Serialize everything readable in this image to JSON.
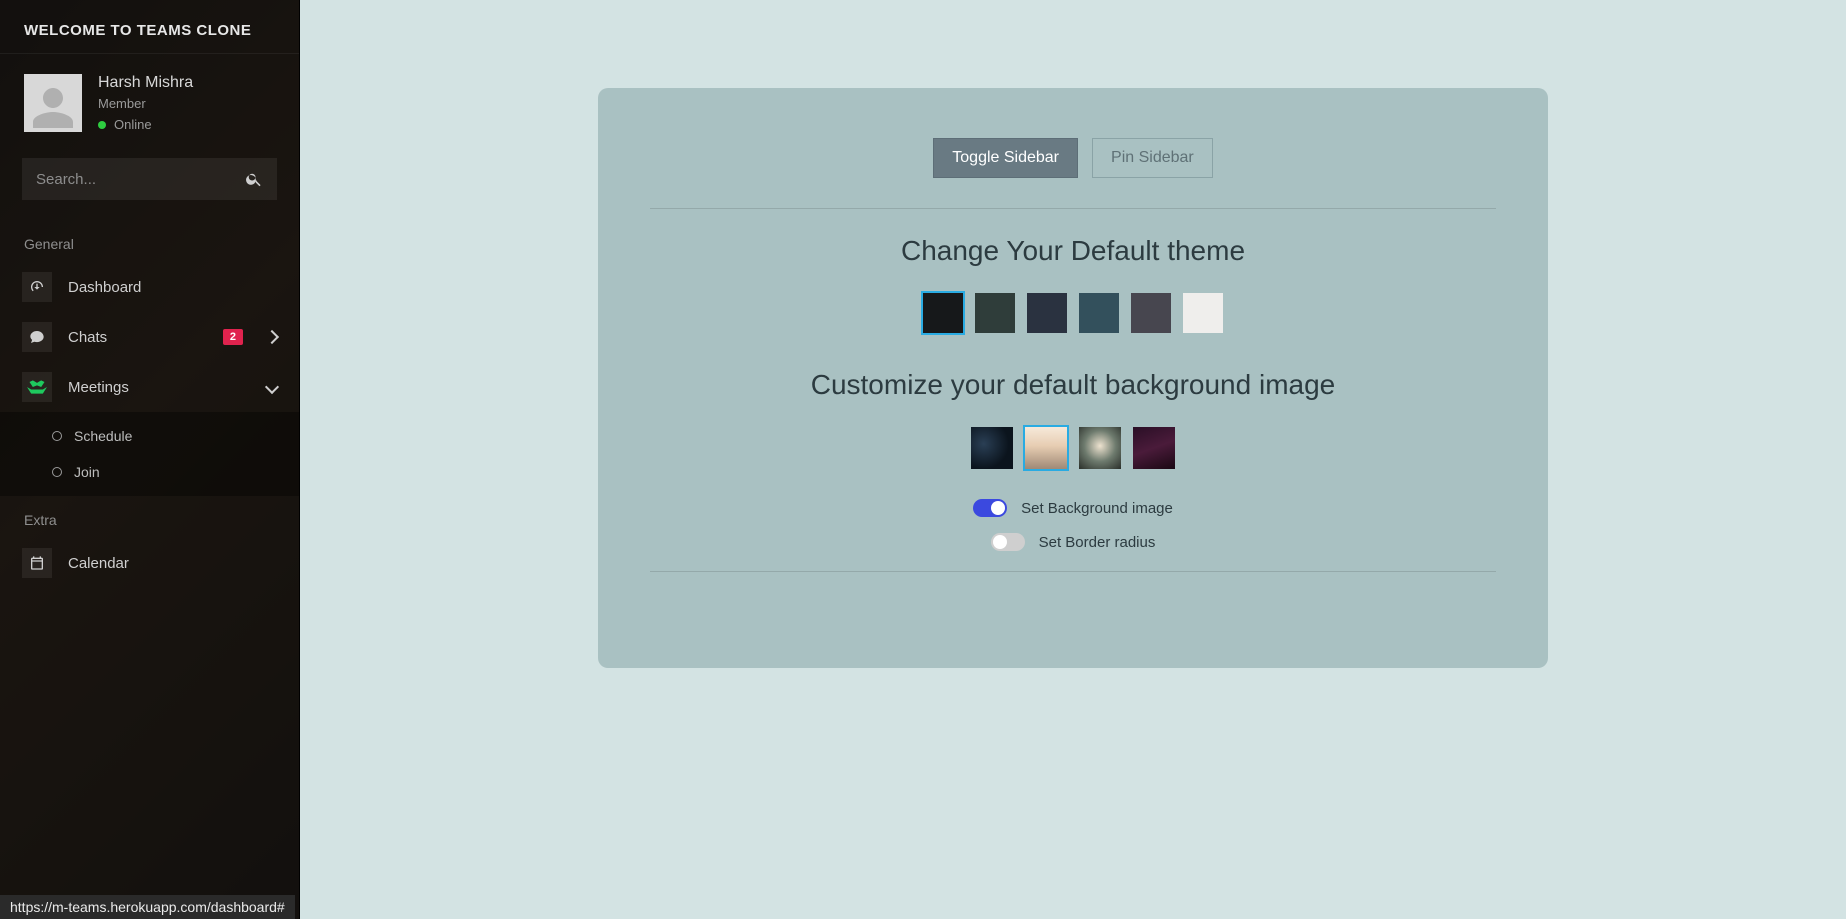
{
  "sidebar": {
    "title": "WELCOME TO TEAMS CLONE",
    "profile": {
      "name": "Harsh Mishra",
      "role": "Member",
      "status_text": "Online"
    },
    "search_placeholder": "Search...",
    "sections": {
      "general_label": "General",
      "extra_label": "Extra"
    },
    "items": {
      "dashboard": "Dashboard",
      "chats": "Chats",
      "chats_badge": "2",
      "meetings": "Meetings",
      "calendar": "Calendar"
    },
    "meetings_sub": {
      "schedule": "Schedule",
      "join": "Join"
    }
  },
  "panel": {
    "toggle_sidebar": "Toggle Sidebar",
    "pin_sidebar": "Pin Sidebar",
    "theme_heading": "Change Your Default theme",
    "bg_heading": "Customize your default background image",
    "set_bg_label": "Set Background image",
    "set_radius_label": "Set Border radius",
    "themes": [
      {
        "color": "#16181a",
        "selected": true
      },
      {
        "color": "#2f3d3a",
        "selected": false
      },
      {
        "color": "#2a3240",
        "selected": false
      },
      {
        "color": "#33505c",
        "selected": false
      },
      {
        "color": "#47464f",
        "selected": false
      },
      {
        "color": "#efeeec",
        "selected": false
      }
    ],
    "backgrounds": [
      {
        "cls": "bg1",
        "selected": false
      },
      {
        "cls": "bg2",
        "selected": true
      },
      {
        "cls": "bg3",
        "selected": false
      },
      {
        "cls": "bg4",
        "selected": false
      }
    ],
    "toggle_bg_on": true,
    "toggle_radius_on": false
  },
  "status_bar_url": "https://m-teams.herokuapp.com/dashboard#"
}
